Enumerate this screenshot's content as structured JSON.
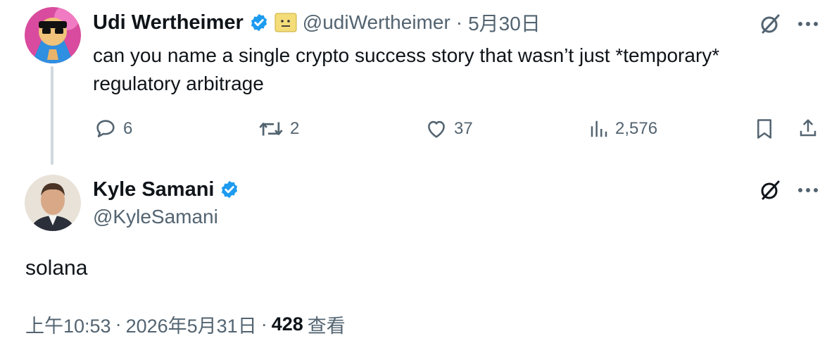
{
  "parent_tweet": {
    "author_name": "Udi Wertheimer",
    "author_handle": "@udiWertheimer",
    "date": "5月30日",
    "separator": "·",
    "text": "can you name a single crypto success story that wasn’t just *temporary* regulatory arbitrage",
    "replies": "6",
    "retweets": "2",
    "likes": "37",
    "views": "2,576"
  },
  "main_tweet": {
    "author_name": "Kyle Samani",
    "author_handle": "@KyleSamani",
    "text": "solana",
    "time": "上午10:53",
    "date": "2026年5月31日",
    "separator": "·",
    "views_count": "428",
    "views_label": "查看"
  },
  "colors": {
    "verified": "#1d9bf0",
    "secondary_text": "#536471",
    "primary_text": "#0f1419",
    "thread_line": "#cfd9de"
  }
}
